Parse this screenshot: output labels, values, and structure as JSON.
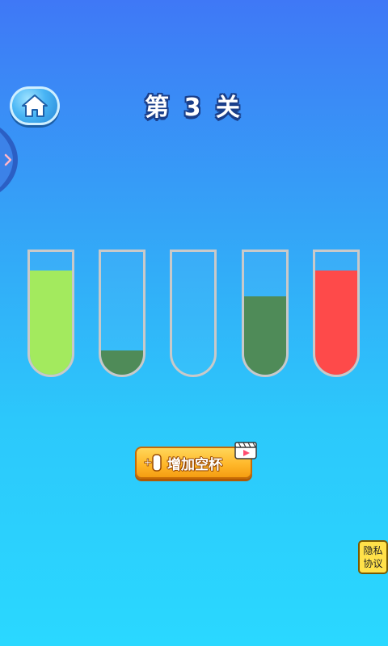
{
  "header": {
    "level_prefix": "第",
    "level_number": "3",
    "level_suffix": "关",
    "home_icon": "home-icon",
    "side_tab_icon": "chevron-right-icon"
  },
  "tubes": [
    {
      "color": "#a3ea5e",
      "fill": 0.85
    },
    {
      "color": "#4f8b58",
      "fill": 0.2
    },
    {
      "color": "#ffffff",
      "fill": 0
    },
    {
      "color": "#4f8b58",
      "fill": 0.64
    },
    {
      "color": "#fe4a4a",
      "fill": 0.85
    }
  ],
  "add_cup": {
    "label": "增加空杯",
    "icon": "plus-cup-icon",
    "badge_icon": "video-play-icon"
  },
  "privacy": {
    "line1": "隐私",
    "line2": "协议"
  },
  "colors": {
    "tube_border": "#c9c9c9",
    "button_orange": "#ffb82a",
    "privacy_yellow": "#ffe14a"
  }
}
